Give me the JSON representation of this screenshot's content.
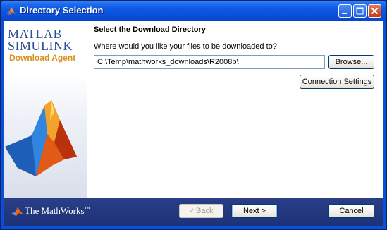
{
  "window": {
    "title": "Directory Selection"
  },
  "branding": {
    "line1": "MATLAB",
    "line2": "SIMULINK",
    "product": "Download Agent",
    "company": "The MathWorks",
    "trademark": "™"
  },
  "main": {
    "heading": "Select the Download Directory",
    "question": "Where would you like your files to be downloaded to?",
    "path_value": "C:\\Temp\\mathworks_downloads\\R2008b\\",
    "browse_label": "Browse...",
    "connection_label": "Connection Settings"
  },
  "footer": {
    "back_label": "< Back",
    "next_label": "Next >",
    "cancel_label": "Cancel"
  },
  "colors": {
    "titlebar": "#0b56e4",
    "footer": "#21367d",
    "logo_blue": "#2d4f95",
    "logo_orange": "#d9901f"
  },
  "icons": [
    "matlab-membrane-icon",
    "minimize-icon",
    "maximize-icon",
    "close-icon",
    "mathworks-logo-icon"
  ]
}
